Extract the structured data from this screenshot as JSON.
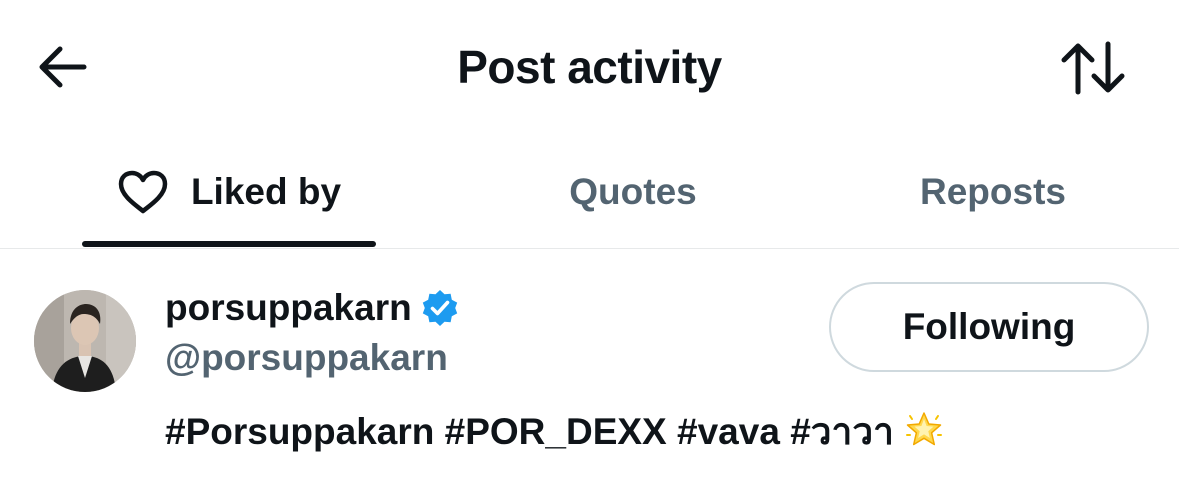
{
  "header": {
    "title": "Post activity",
    "back_icon": "arrow-left-icon",
    "sort_icon": "sort-arrows-icon"
  },
  "tabs": [
    {
      "label": "Liked by",
      "icon": "heart-icon",
      "active": true
    },
    {
      "label": "Quotes",
      "active": false
    },
    {
      "label": "Reposts",
      "active": false
    }
  ],
  "users": [
    {
      "display_name": "porsuppakarn",
      "verified": true,
      "handle": "@porsuppakarn",
      "bio": "#Porsuppakarn #POR_DEXX #vava #วาวา",
      "bio_emoji": "glowing-star-icon",
      "follow_label": "Following"
    }
  ],
  "colors": {
    "text_primary": "#0f1419",
    "text_secondary": "#536471",
    "verified_blue": "#1d9bf0",
    "divider": "#e7e9ea",
    "button_border": "#cfd9de"
  }
}
